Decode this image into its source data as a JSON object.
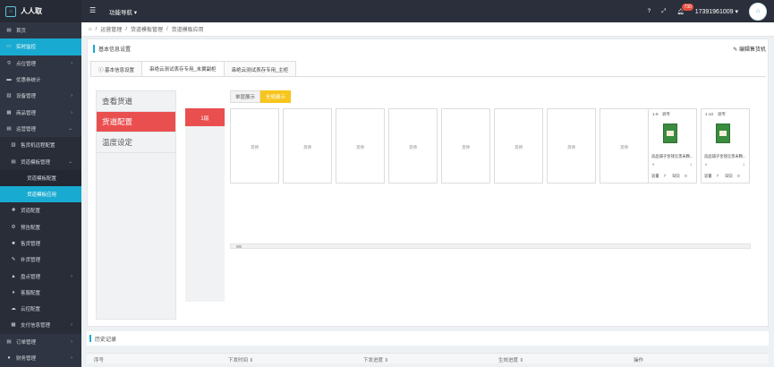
{
  "app": {
    "logo_mark": "⌂",
    "title": "人人取"
  },
  "topbar": {
    "menu_icon": "hamburger-icon",
    "nav_label": "功能导航 ▾",
    "help": "?",
    "expand": "⤢",
    "bell_badge": "730",
    "username": "17391961009 ▾",
    "avatar_text": "⌂"
  },
  "sidebar": {
    "items": [
      {
        "label": "首页",
        "icon": "▤"
      },
      {
        "label": "实时监控",
        "icon": "▭"
      },
      {
        "label": "点位管理",
        "icon": "⚲",
        "arrow": "›"
      },
      {
        "label": "优惠券统计",
        "icon": "▬"
      },
      {
        "label": "设备管理",
        "icon": "▥",
        "arrow": "›"
      },
      {
        "label": "商品管理",
        "icon": "▦",
        "arrow": "›"
      },
      {
        "label": "运营管理",
        "icon": "▤",
        "arrow": "⌄"
      },
      {
        "label": "售货机远程配置",
        "icon": "▥"
      },
      {
        "label": "货道模板管理",
        "icon": "▤",
        "arrow": "⌄"
      },
      {
        "label": "货道模板配置"
      },
      {
        "label": "货道模板应用"
      },
      {
        "label": "货道配置",
        "icon": "✚"
      },
      {
        "label": "预告配置",
        "icon": "⚙"
      },
      {
        "label": "售货管理",
        "icon": "■"
      },
      {
        "label": "补货管理",
        "icon": "✎"
      },
      {
        "label": "盘点管理",
        "icon": "▲",
        "arrow": "›"
      },
      {
        "label": "客服配置",
        "icon": "♦"
      },
      {
        "label": "云控配置",
        "icon": "☁"
      },
      {
        "label": "支付信息管理",
        "icon": "▦",
        "arrow": "›"
      },
      {
        "label": "订单管理",
        "icon": "▤",
        "arrow": "›"
      },
      {
        "label": "财务管理",
        "icon": "●",
        "arrow": "›"
      }
    ]
  },
  "breadcrumb": {
    "home_icon": "⌂",
    "items": [
      "运营管理",
      "货道模板管理",
      "货道模板应用"
    ],
    "sep": "/"
  },
  "panel": {
    "title": "基本信息设置",
    "edit_label": "✎ 编辑售货机",
    "tabs": [
      "ⓘ 基本信息设置",
      "串绝云测试表存专用_末翼副柜",
      "串绝云测试表存专用_主柜"
    ]
  },
  "left_menu": [
    "查看货道",
    "货道配置",
    "温度设定"
  ],
  "view_buttons": [
    "单层展示",
    "全局展示"
  ],
  "floor_label": "1层",
  "empty_slot_text": "货待",
  "slots": [
    {
      "filled": false
    },
    {
      "filled": false
    },
    {
      "filled": false
    },
    {
      "filled": false
    },
    {
      "filled": false
    },
    {
      "filled": false
    },
    {
      "filled": false
    },
    {
      "filled": false
    },
    {
      "filled": true,
      "no": "1-9",
      "label": "调专",
      "name": "良品铺子金钱豆黑米颗...",
      "mini_left": "¥",
      "mini_right": "1",
      "cap_label": "容量",
      "cap": "7",
      "warn_label": "缺货",
      "warn": "0"
    },
    {
      "filled": true,
      "no": "1-10",
      "label": "调专",
      "name": "良品铺子金钱豆黑米颗...",
      "mini_left": "¥",
      "mini_right": "1",
      "cap_label": "容量",
      "cap": "7",
      "warn_label": "缺货",
      "warn": "0"
    }
  ],
  "history": {
    "title": "历史记录"
  },
  "history_table": {
    "columns": [
      "序号",
      "下发时间 ⇕",
      "下发进度 ⇕",
      "生效进度 ⇕",
      "操作"
    ]
  }
}
